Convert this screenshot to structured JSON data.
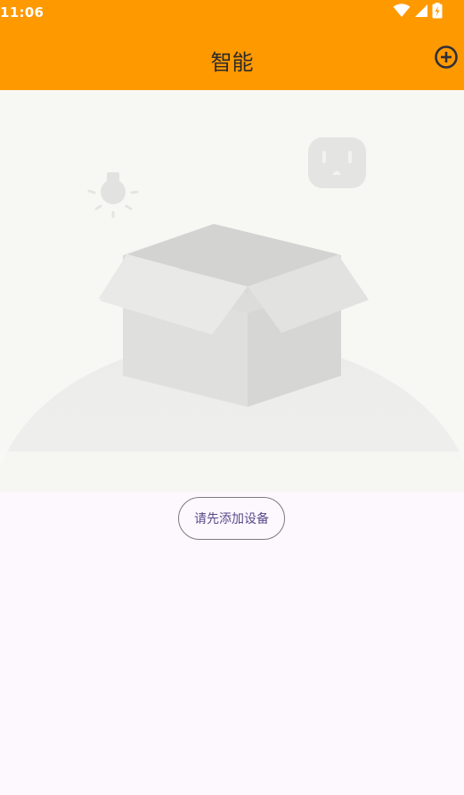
{
  "status_bar": {
    "time": "11:06",
    "icons": [
      "wifi-icon",
      "cellular-signal-icon",
      "battery-charging-icon"
    ]
  },
  "toolbar": {
    "title": "智能",
    "add_icon": "add-circle-icon"
  },
  "empty_state": {
    "illustration": "empty-box-illustration",
    "button_label": "请先添加设备"
  },
  "colors": {
    "primary": "#ff9900",
    "background": "#fcf8fd",
    "button_text": "#5b4a8c",
    "button_border": "#7d7a82"
  }
}
